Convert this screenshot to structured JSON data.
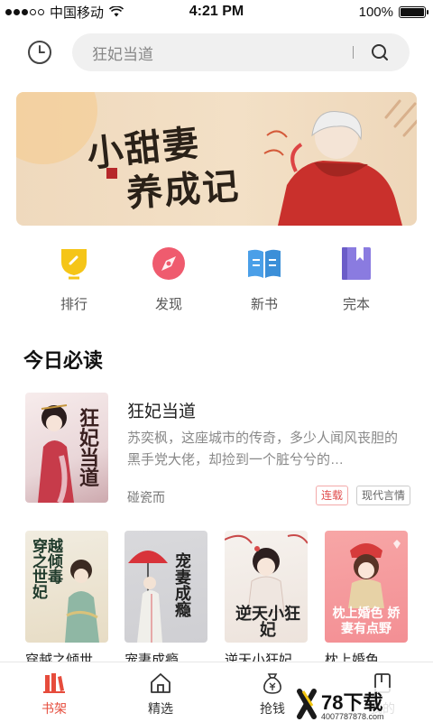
{
  "status_bar": {
    "carrier": "中国移动",
    "time": "4:21 PM",
    "battery": "100%"
  },
  "search": {
    "placeholder": "狂妃当道"
  },
  "banner": {
    "title_line1": "小甜妻",
    "title_line2": "养成记"
  },
  "categories": [
    {
      "label": "排行",
      "icon": "trophy-icon"
    },
    {
      "label": "发现",
      "icon": "compass-icon"
    },
    {
      "label": "新书",
      "icon": "open-book-icon"
    },
    {
      "label": "完本",
      "icon": "bookmark-book-icon"
    }
  ],
  "section": {
    "title": "今日必读"
  },
  "featured": {
    "title": "狂妃当道",
    "description": "苏奕枫，这座城市的传奇，多少人闻风丧胆的黑手党大佬，却捡到一个脏兮兮的…",
    "author": "碰瓷而",
    "tags": [
      "连载",
      "现代言情"
    ],
    "cover_text": "狂妃当道"
  },
  "books": [
    {
      "title": "穿越之倾世",
      "cover_text": "穿越之倾世毒妃"
    },
    {
      "title": "宠妻成瘾",
      "cover_text": "宠妻成瘾"
    },
    {
      "title": "逆天小狂妃",
      "cover_text": "逆天小狂妃"
    },
    {
      "title": "枕上婚色",
      "cover_text": "枕上婚色 娇妻有点野"
    }
  ],
  "tabbar": [
    {
      "label": "书架",
      "icon": "bookshelf-icon",
      "active": true
    },
    {
      "label": "精选",
      "icon": "home-icon",
      "active": false
    },
    {
      "label": "抢钱",
      "icon": "money-bag-icon",
      "active": false
    },
    {
      "label": "我的",
      "icon": "profile-icon",
      "active": false
    }
  ],
  "watermark": {
    "brand": "78下载",
    "phone": "4007787878.com"
  },
  "colors": {
    "accent": "#e64c3c",
    "trophy": "#f5c518",
    "discover": "#ef5b6e",
    "newbook": "#4a9fe8",
    "complete": "#8a7be0"
  }
}
